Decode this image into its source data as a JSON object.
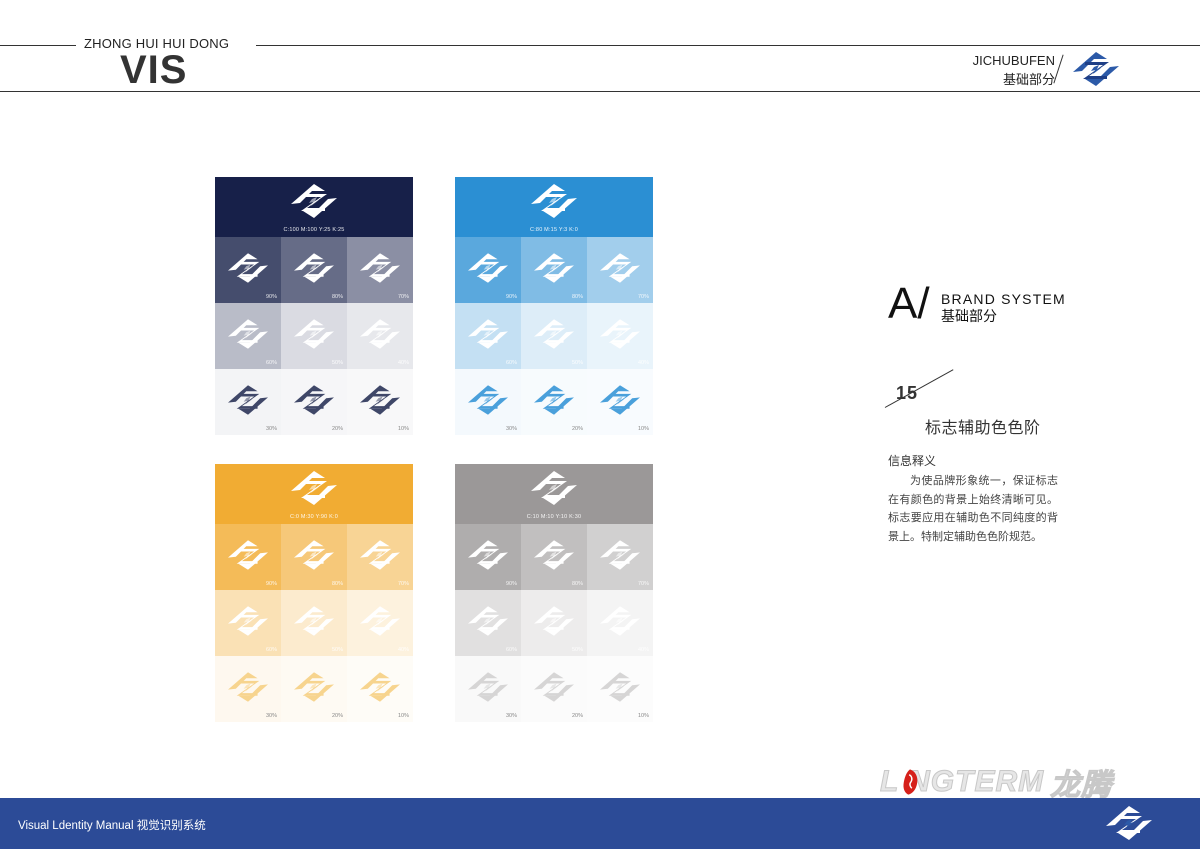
{
  "header": {
    "brand_small": "ZHONG HUI HUI DONG",
    "brand_big": "VIS",
    "section_en": "JICHUBUFEN",
    "section_cn": "基础部分"
  },
  "section": {
    "letter": "A/",
    "title_en": "BRAND SYSTEM",
    "title_cn": "基础部分",
    "number": "15",
    "subtitle": "标志辅助色色阶",
    "info_title": "信息释义",
    "info_body": "为使品牌形象统一，保证标志在有颜色的背景上始终清晰可见。标志要应用在辅助色不同纯度的背景上。特制定辅助色色阶规范。"
  },
  "palettes": [
    {
      "name": "navy",
      "color": "#172049",
      "cmyk": "C:100 M:100 Y:25 K:25",
      "levels": [
        "90%",
        "80%",
        "70%",
        "60%",
        "50%",
        "40%",
        "30%",
        "20%",
        "10%"
      ],
      "alphas": [
        0.8,
        0.66,
        0.5,
        0.3,
        0.16,
        0.1,
        0.05,
        0.04,
        0.03
      ],
      "logo_on_light": "#3f4768"
    },
    {
      "name": "blue",
      "color": "#2b8fd3",
      "cmyk": "C:80 M:15 Y:3 K:0",
      "levels": [
        "90%",
        "80%",
        "70%",
        "60%",
        "50%",
        "40%",
        "30%",
        "20%",
        "10%"
      ],
      "alphas": [
        0.78,
        0.6,
        0.44,
        0.28,
        0.16,
        0.1,
        0.05,
        0.04,
        0.03
      ],
      "logo_on_light": "#4aa0db"
    },
    {
      "name": "orange",
      "color": "#f1ac33",
      "cmyk": "C:0 M:30 Y:90 K:0",
      "levels": [
        "90%",
        "80%",
        "70%",
        "60%",
        "50%",
        "40%",
        "30%",
        "20%",
        "10%"
      ],
      "alphas": [
        0.82,
        0.66,
        0.52,
        0.36,
        0.24,
        0.16,
        0.08,
        0.06,
        0.04
      ],
      "logo_on_light": "#f7d48e"
    },
    {
      "name": "gray",
      "color": "#9b9898",
      "cmyk": "C:10 M:10 Y:10 K:30",
      "levels": [
        "90%",
        "80%",
        "70%",
        "60%",
        "50%",
        "40%",
        "30%",
        "20%",
        "10%"
      ],
      "alphas": [
        0.8,
        0.62,
        0.46,
        0.3,
        0.18,
        0.11,
        0.06,
        0.04,
        0.03
      ],
      "logo_on_light": "#d6d5d5"
    }
  ],
  "longterm": {
    "text": "L NGTERM",
    "cn": "龙腾",
    "accent": "#d6201a"
  },
  "footer": {
    "text": "Visual Ldentity Manual  视觉识别系统",
    "color": "#2c4b97"
  }
}
